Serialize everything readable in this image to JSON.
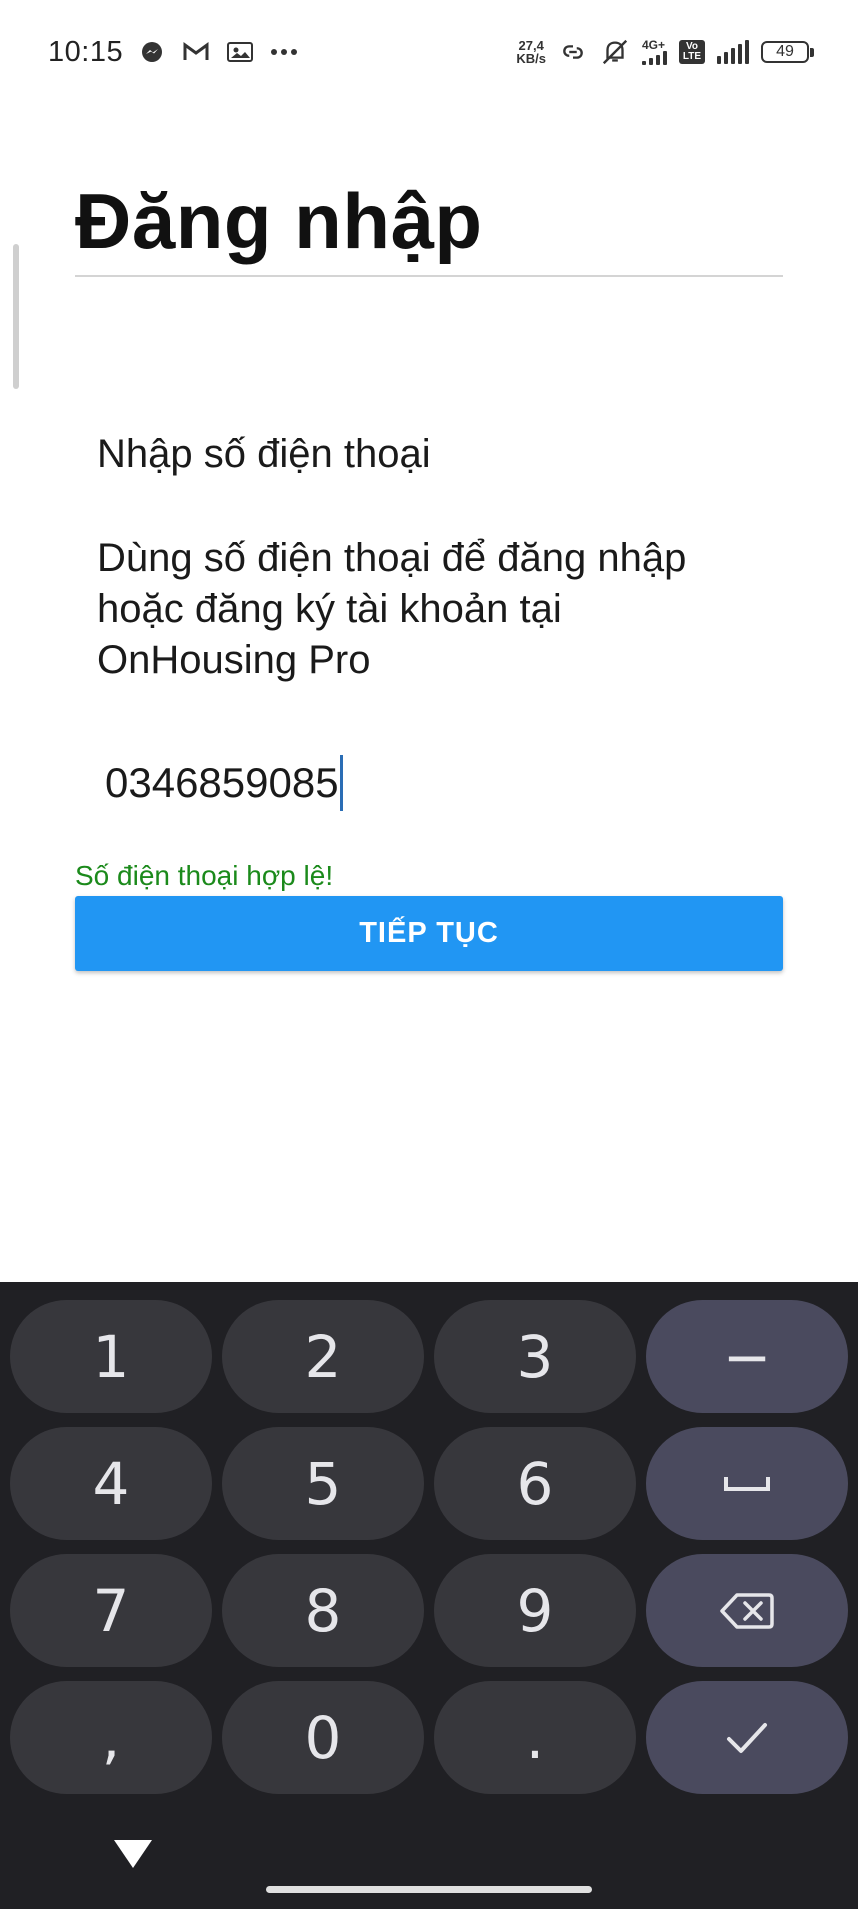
{
  "status_bar": {
    "time": "10:15",
    "net_speed_value": "27,4",
    "net_speed_unit": "KB/s",
    "network_type": "4G+",
    "volte": "Vo LTE",
    "battery": "49",
    "left_icons": [
      "messenger-icon",
      "gmail-icon",
      "photo-icon",
      "more-dots-icon"
    ],
    "right_icons": [
      "link-icon",
      "mute-icon",
      "signal-icon",
      "signal-icon"
    ]
  },
  "page": {
    "title": "Đăng nhập",
    "label": "Nhập số điện thoại",
    "description": "Dùng số điện thoại để đăng nhập hoặc đăng ký tài khoản tại OnHousing Pro",
    "phone_value": "0346859085",
    "valid_message": "Số điện thoại hợp lệ!",
    "continue_label": "TIẾP TỤC"
  },
  "colors": {
    "accent": "#2196f3",
    "valid": "#1b8a1b",
    "keyboard_bg": "#202024",
    "key_bg": "#37373c",
    "key_fn_bg": "#4a4a5e"
  },
  "keyboard": {
    "keys": [
      {
        "label": "1",
        "name": "key-1"
      },
      {
        "label": "2",
        "name": "key-2"
      },
      {
        "label": "3",
        "name": "key-3"
      },
      {
        "label": "−",
        "name": "key-minus"
      },
      {
        "label": "4",
        "name": "key-4"
      },
      {
        "label": "5",
        "name": "key-5"
      },
      {
        "label": "6",
        "name": "key-6"
      },
      {
        "label": "␣",
        "name": "key-space"
      },
      {
        "label": "7",
        "name": "key-7"
      },
      {
        "label": "8",
        "name": "key-8"
      },
      {
        "label": "9",
        "name": "key-9"
      },
      {
        "label": "⌫",
        "name": "key-backspace"
      },
      {
        "label": ",",
        "name": "key-comma"
      },
      {
        "label": "0",
        "name": "key-0"
      },
      {
        "label": ".",
        "name": "key-period"
      },
      {
        "label": "✓",
        "name": "key-enter"
      }
    ]
  }
}
